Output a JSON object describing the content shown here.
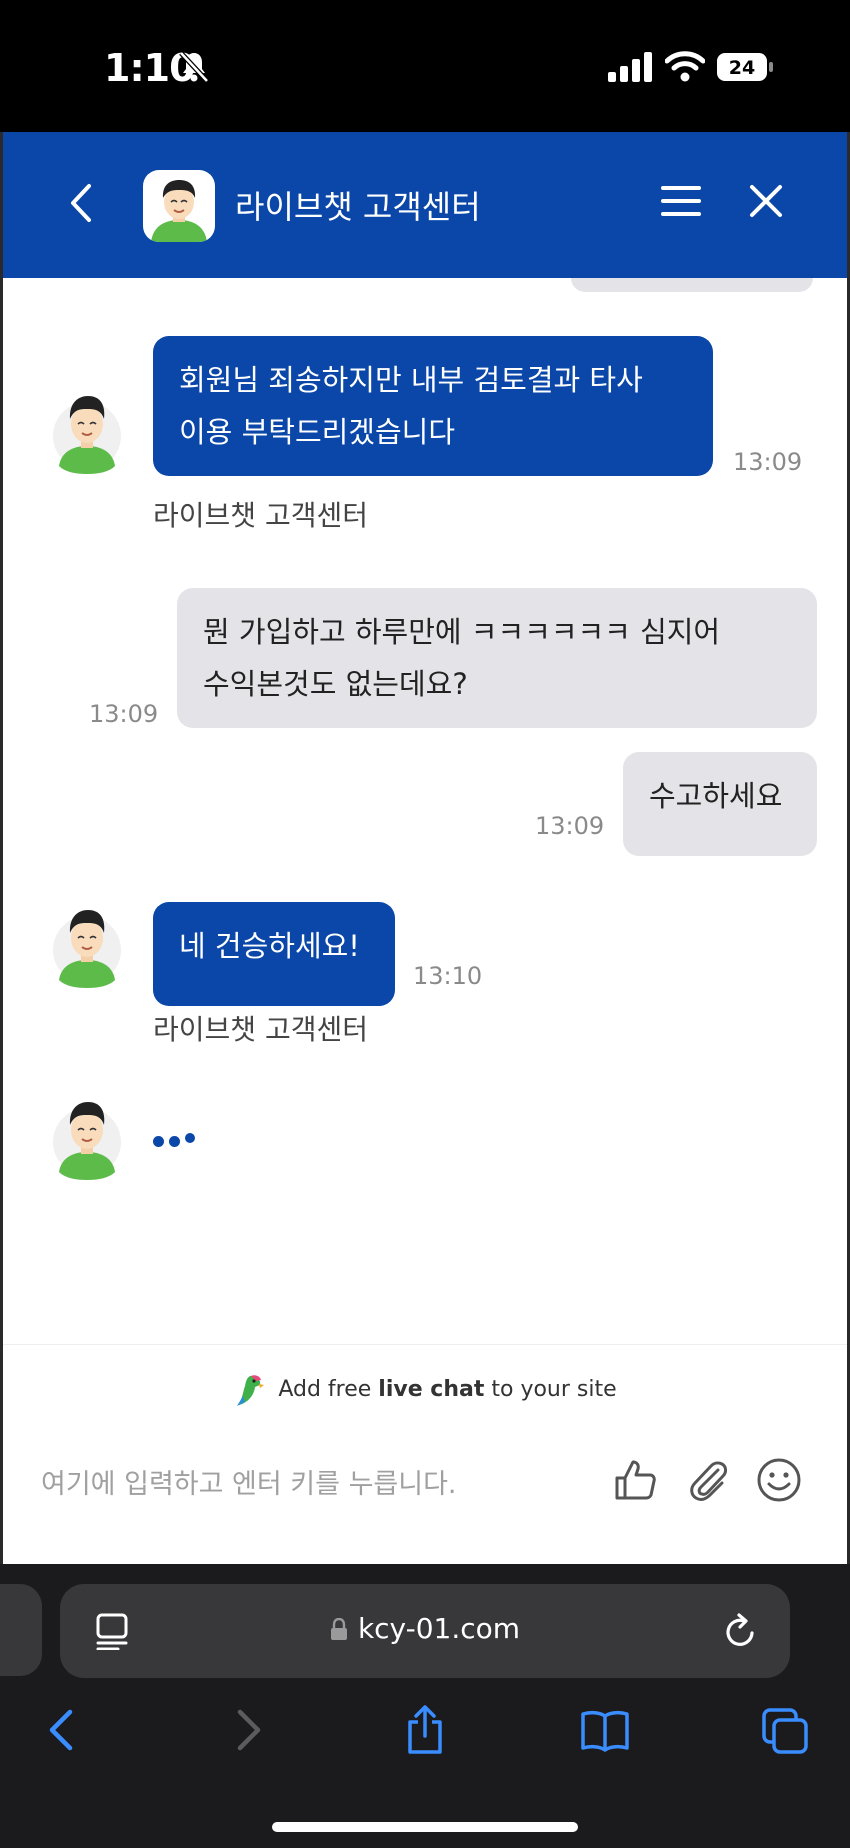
{
  "status_bar": {
    "time": "1:10",
    "battery": "24"
  },
  "header": {
    "title": "라이브챗 고객센터"
  },
  "messages": {
    "m1": {
      "lines": [
        "회원님 죄송하지만 내부 검토결과 타사",
        "이용 부탁드리겠습니다"
      ],
      "time": "13:09",
      "sender": "라이브챗 고객센터"
    },
    "m2": {
      "lines": [
        "뭔 가입하고 하루만에 ㅋㅋㅋㅋㅋㅋ 심지어",
        "수익본것도 없는데요?"
      ],
      "time": "13:09"
    },
    "m3": {
      "text": "수고하세요",
      "time": "13:09"
    },
    "m4": {
      "text": "네 건승하세요!",
      "time": "13:10",
      "sender": "라이브챗 고객센터"
    }
  },
  "promo": {
    "prefix": "Add free ",
    "bold": "live chat",
    "suffix": " to your site"
  },
  "input": {
    "placeholder": "여기에 입력하고 엔터 키를 누릅니다."
  },
  "browser": {
    "url": "kcy-01.com"
  },
  "colors": {
    "brand": "#0a47a8",
    "user_bubble": "#e4e4e8"
  },
  "icons": [
    "back-icon",
    "menu-icon",
    "close-icon",
    "thumbs-up-icon",
    "paperclip-icon",
    "smiley-icon",
    "reader-icon",
    "lock-icon",
    "reload-icon",
    "share-icon",
    "bookmarks-icon",
    "tabs-icon"
  ]
}
